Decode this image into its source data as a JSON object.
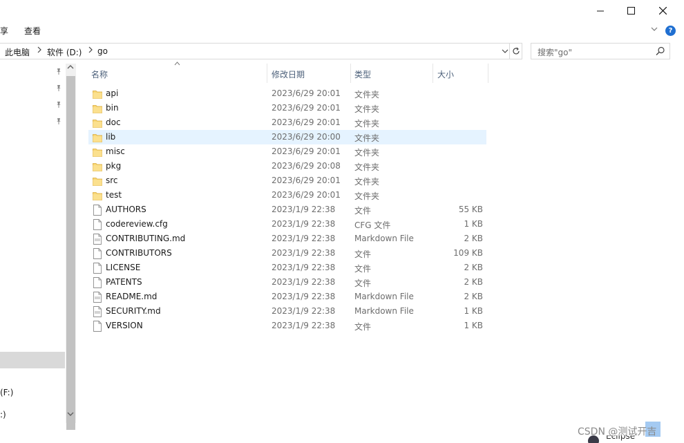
{
  "window": {
    "minimize_glyph": "—",
    "maximize_glyph": "☐",
    "close_glyph": "✕"
  },
  "ribbon": {
    "tabs": [
      "享",
      "查看"
    ]
  },
  "address": {
    "crumbs": [
      "此电脑",
      "软件 (D:)",
      "go"
    ]
  },
  "search": {
    "placeholder": "搜索\"go\""
  },
  "navpane": {
    "drives": [
      "(F:)",
      ":)"
    ]
  },
  "columns": {
    "name": "名称",
    "date": "修改日期",
    "type": "类型",
    "size": "大小"
  },
  "files": [
    {
      "name": "api",
      "date": "2023/6/29 20:01",
      "type": "文件夹",
      "size": "",
      "icon": "folder-icon"
    },
    {
      "name": "bin",
      "date": "2023/6/29 20:01",
      "type": "文件夹",
      "size": "",
      "icon": "folder-icon"
    },
    {
      "name": "doc",
      "date": "2023/6/29 20:01",
      "type": "文件夹",
      "size": "",
      "icon": "folder-icon"
    },
    {
      "name": "lib",
      "date": "2023/6/29 20:00",
      "type": "文件夹",
      "size": "",
      "icon": "folder-icon",
      "selected": true
    },
    {
      "name": "misc",
      "date": "2023/6/29 20:01",
      "type": "文件夹",
      "size": "",
      "icon": "folder-icon"
    },
    {
      "name": "pkg",
      "date": "2023/6/29 20:08",
      "type": "文件夹",
      "size": "",
      "icon": "folder-icon"
    },
    {
      "name": "src",
      "date": "2023/6/29 20:01",
      "type": "文件夹",
      "size": "",
      "icon": "folder-icon"
    },
    {
      "name": "test",
      "date": "2023/6/29 20:01",
      "type": "文件夹",
      "size": "",
      "icon": "folder-icon"
    },
    {
      "name": "AUTHORS",
      "date": "2023/1/9 22:38",
      "type": "文件",
      "size": "55 KB",
      "icon": "file-icon"
    },
    {
      "name": "codereview.cfg",
      "date": "2023/1/9 22:38",
      "type": "CFG 文件",
      "size": "1 KB",
      "icon": "file-icon"
    },
    {
      "name": "CONTRIBUTING.md",
      "date": "2023/1/9 22:38",
      "type": "Markdown File",
      "size": "2 KB",
      "icon": "markdown-file-icon"
    },
    {
      "name": "CONTRIBUTORS",
      "date": "2023/1/9 22:38",
      "type": "文件",
      "size": "109 KB",
      "icon": "file-icon"
    },
    {
      "name": "LICENSE",
      "date": "2023/1/9 22:38",
      "type": "文件",
      "size": "2 KB",
      "icon": "file-icon"
    },
    {
      "name": "PATENTS",
      "date": "2023/1/9 22:38",
      "type": "文件",
      "size": "2 KB",
      "icon": "file-icon"
    },
    {
      "name": "README.md",
      "date": "2023/1/9 22:38",
      "type": "Markdown File",
      "size": "2 KB",
      "icon": "markdown-file-icon"
    },
    {
      "name": "SECURITY.md",
      "date": "2023/1/9 22:38",
      "type": "Markdown File",
      "size": "1 KB",
      "icon": "markdown-file-icon"
    },
    {
      "name": "VERSION",
      "date": "2023/1/9 22:38",
      "type": "文件",
      "size": "1 KB",
      "icon": "file-icon"
    }
  ],
  "watermark": {
    "text": "CSDN @测试开吉",
    "background_fragment": "Eclipse"
  },
  "colors": {
    "selected_row": "#e5f3ff",
    "header_text": "#4c607a",
    "folder": "#f8d775",
    "help_button": "#1f6fd1"
  }
}
